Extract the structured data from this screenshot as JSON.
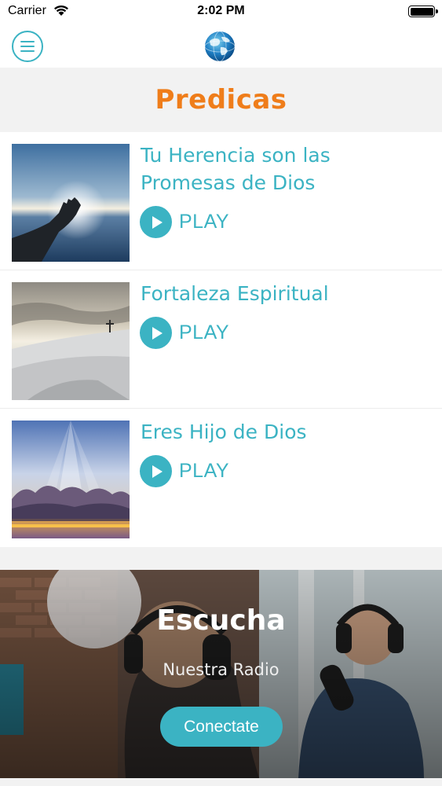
{
  "status_bar": {
    "carrier": "Carrier",
    "time": "2:02 PM",
    "wifi_icon": "wifi-icon",
    "battery_icon": "battery-full-icon"
  },
  "nav": {
    "menu_icon": "hamburger-menu-icon",
    "logo_icon": "globe-logo-icon"
  },
  "section": {
    "title": "Predicas"
  },
  "sermons": [
    {
      "title": "Tu Herencia son las Promesas de Dios",
      "play_label": "PLAY",
      "thumbnail": "hand-reaching-sunset-over-lake"
    },
    {
      "title": "Fortaleza Espiritual",
      "play_label": "PLAY",
      "thumbnail": "cross-on-snowy-hill"
    },
    {
      "title": "Eres Hijo de Dios",
      "play_label": "PLAY",
      "thumbnail": "sun-rays-through-clouds"
    }
  ],
  "radio": {
    "title": "Escucha",
    "subtitle": "Nuestra Radio",
    "button_label": "Conectate",
    "background": "podcast-studio-two-men-headphones"
  },
  "colors": {
    "accent": "#3bb3c3",
    "title_orange": "#ef7d1a",
    "background": "#f2f2f2"
  }
}
